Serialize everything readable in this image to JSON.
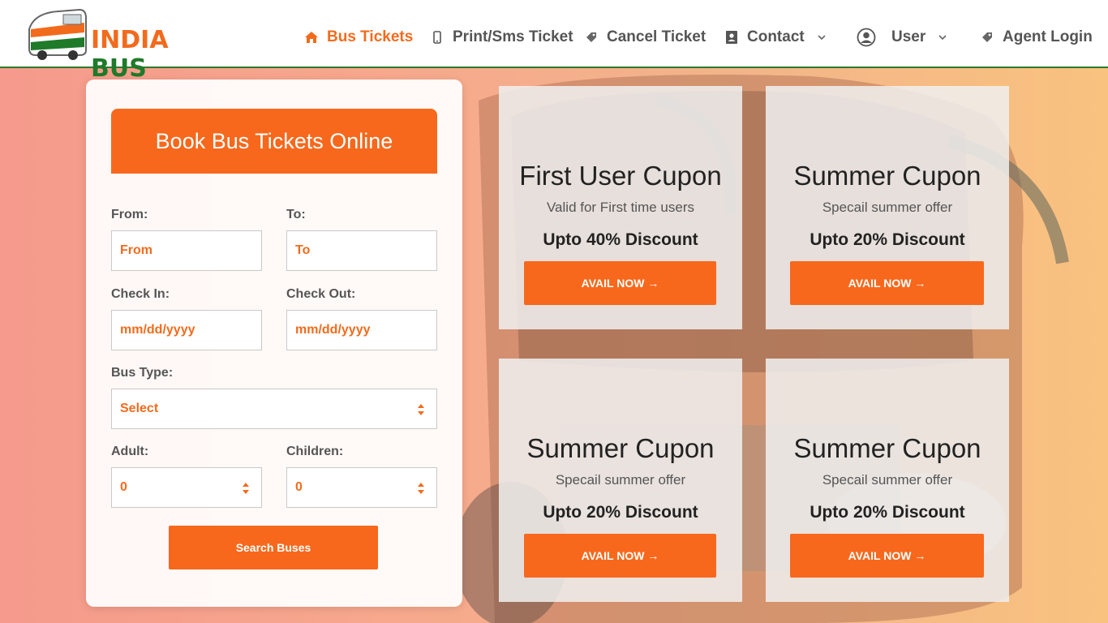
{
  "brand": {
    "word1": "INDIA",
    "word2": "BUS",
    "logo_icon": "bus-logo-icon"
  },
  "nav": {
    "bus_tickets": "Bus Tickets",
    "print_sms": "Print/Sms Ticket",
    "cancel_ticket": "Cancel Ticket",
    "contact": "Contact",
    "user": "User",
    "agent_login": "Agent Login"
  },
  "booking": {
    "title": "Book Bus Tickets Online",
    "from_label": "From:",
    "from_value": "From",
    "to_label": "To:",
    "to_value": "To",
    "checkin_label": "Check In:",
    "checkin_value": "mm/dd/yyyy",
    "checkout_label": "Check Out:",
    "checkout_value": "mm/dd/yyyy",
    "bustype_label": "Bus Type:",
    "bustype_value": "Select",
    "adult_label": "Adult:",
    "adult_value": "0",
    "children_label": "Children:",
    "children_value": "0",
    "search_label": "Search Buses"
  },
  "coupons": [
    {
      "title": "First User Cupon",
      "subtitle": "Valid for First time users",
      "discount": "Upto 40% Discount",
      "button": "AVAIL NOW →"
    },
    {
      "title": "Summer Cupon",
      "subtitle": "Specail summer offer",
      "discount": "Upto 20% Discount",
      "button": "AVAIL NOW →"
    },
    {
      "title": "Summer Cupon",
      "subtitle": "Specail summer offer",
      "discount": "Upto 20% Discount",
      "button": "AVAIL NOW →"
    },
    {
      "title": "Summer Cupon",
      "subtitle": "Specail summer offer",
      "discount": "Upto 20% Discount",
      "button": "AVAIL NOW →"
    }
  ],
  "colors": {
    "accent": "#f7681c",
    "brand_green": "#1f7a2a",
    "header_border": "#2c7a2a"
  }
}
